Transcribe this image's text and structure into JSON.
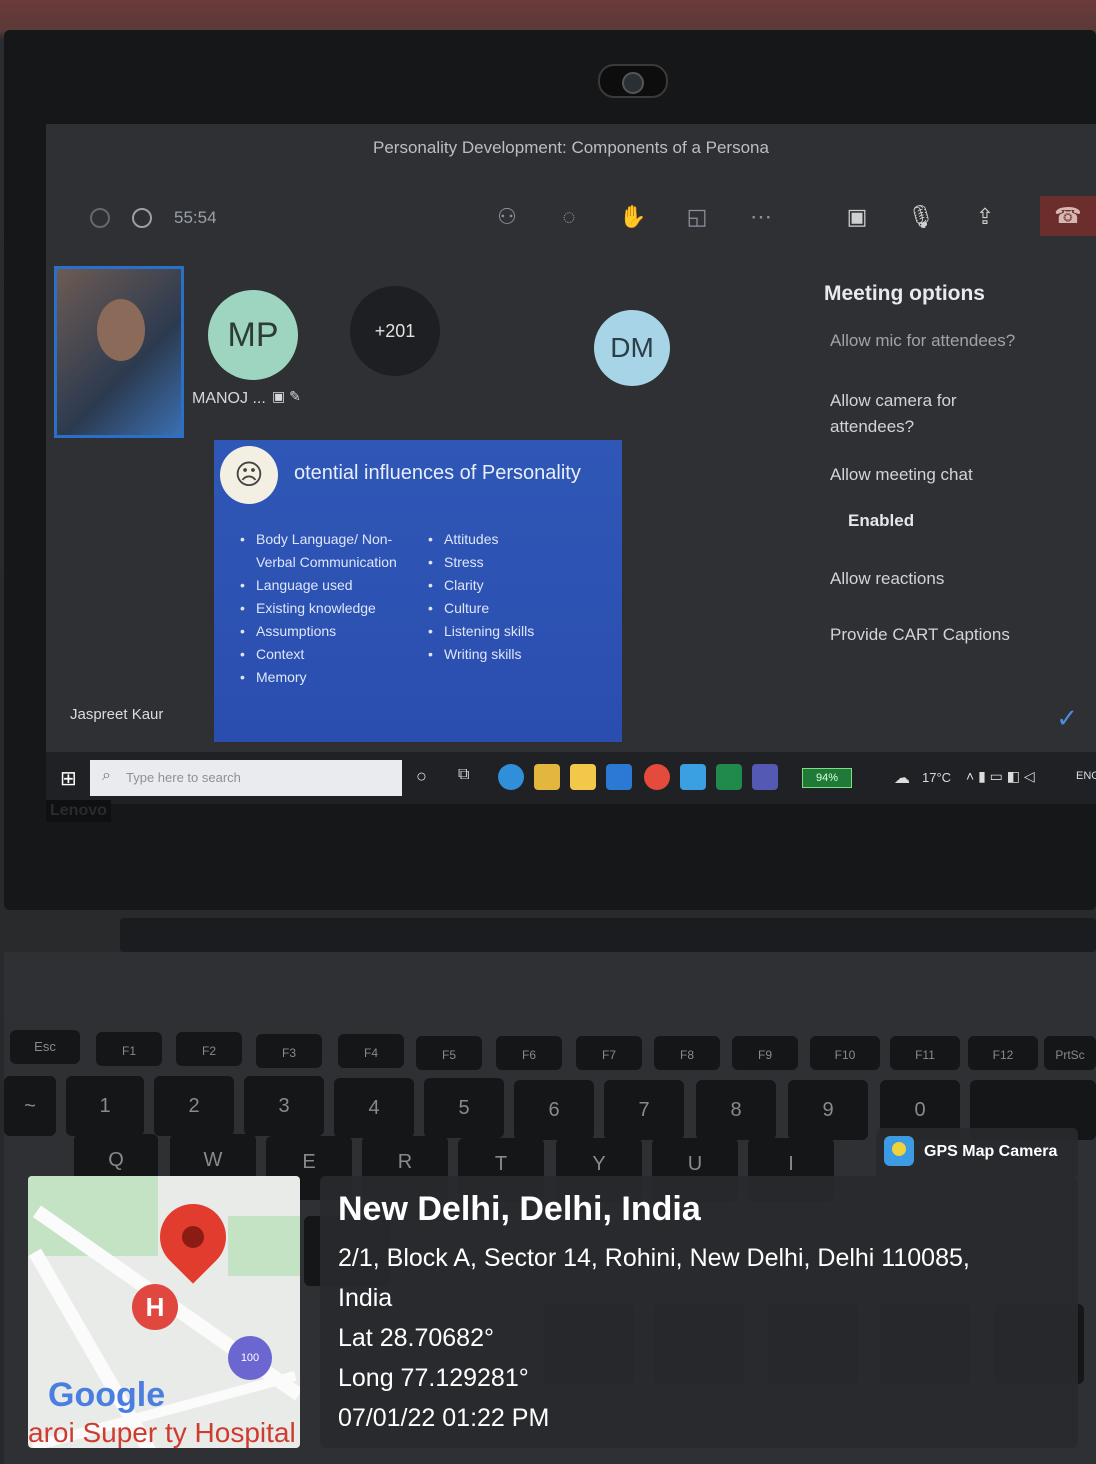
{
  "meeting": {
    "title": "Personality Development: Components of a Persona",
    "timer": "55:54",
    "participants": {
      "mp_initials": "MP",
      "mp_name": "MANOJ ...",
      "overflow": "+201",
      "dm_initials": "DM"
    },
    "presenter_name": "Jaspreet Kaur"
  },
  "slide": {
    "heading": "otential influences of Personality",
    "left_items": [
      "Body Language/ Non-Verbal Communication",
      "Language used",
      "Existing knowledge",
      "Assumptions",
      "Context",
      "Memory"
    ],
    "right_items": [
      "Attitudes",
      "Stress",
      "Clarity",
      "Culture",
      "Listening skills",
      "Writing skills"
    ]
  },
  "meeting_options": {
    "title": "Meeting options",
    "partial": "Allow mic for attendees?",
    "camera": "Allow camera for attendees?",
    "chat": "Allow meeting chat",
    "chat_value": "Enabled",
    "reactions": "Allow reactions",
    "cart": "Provide CART Captions"
  },
  "taskbar": {
    "search_placeholder": "Type here to search",
    "battery": "94%",
    "weather": "17°C",
    "lang": "ENG"
  },
  "brand": "Lenovo",
  "keyboard": {
    "fn_row": [
      "Esc",
      "F1",
      "F2",
      "F3",
      "F4",
      "F5",
      "F6",
      "F7",
      "F8",
      "F9",
      "F10",
      "F11",
      "F12",
      "PrtSc"
    ],
    "num_row": [
      "~",
      "1",
      "2",
      "3",
      "4",
      "5",
      "6",
      "7",
      "8",
      "9",
      "0"
    ],
    "letters": [
      "Q",
      "W",
      "E",
      "R",
      "T",
      "Y",
      "U",
      "I"
    ]
  },
  "gps": {
    "app": "GPS Map Camera",
    "city": "New Delhi, Delhi, India",
    "address1": "2/1, Block A, Sector 14, Rohini, New Delhi, Delhi 110085,",
    "address2": "India",
    "lat": "Lat 28.70682°",
    "long": "Long 77.129281°",
    "datetime": "07/01/22 01:22 PM",
    "map_label": "aroi Super ty Hospital",
    "map_brand": "Google",
    "pin_badge": "100"
  }
}
